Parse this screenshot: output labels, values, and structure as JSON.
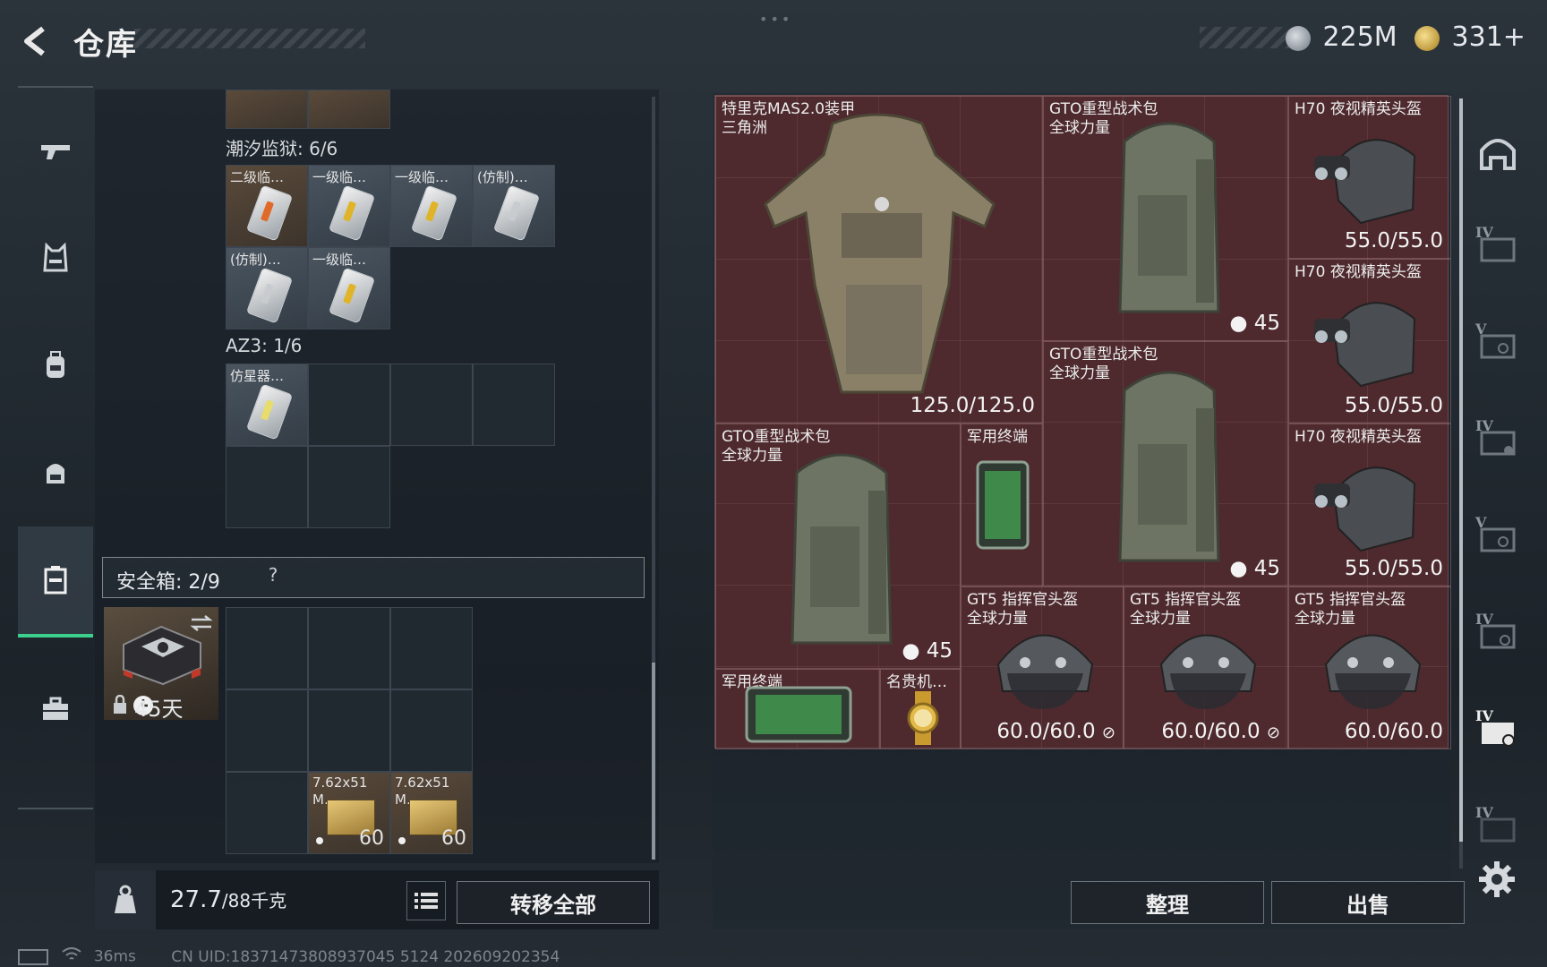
{
  "header": {
    "title": "仓库",
    "currency1": "225M",
    "currency2": "331+",
    "colors": {
      "coin1": "#9aa3ab",
      "coin2": "#d9b44a"
    }
  },
  "left_nav": {
    "items": [
      "gun-icon",
      "vest-icon",
      "bag-icon",
      "helmet-backpack-icon",
      "safebox-icon",
      "briefcase-icon"
    ],
    "active": 4,
    "accent": "#3ccf8e"
  },
  "storage": {
    "section1": {
      "label": "潮汐监狱: 6/6",
      "items": [
        "二级临…",
        "一级临…",
        "一级临…",
        "(仿制)…",
        "(仿制)…",
        "一级临…"
      ]
    },
    "section2": {
      "label": "AZ3: 1/6",
      "items": [
        "仿星器…"
      ]
    }
  },
  "safe_box": {
    "label": "安全箱: 2/9",
    "help": "?",
    "timer": "45天",
    "ammo": [
      {
        "name1": "7.62x51",
        "name2": "M…",
        "count": "60"
      },
      {
        "name1": "7.62x51",
        "name2": "M…",
        "count": "60"
      }
    ]
  },
  "bottom": {
    "weight": "27.7",
    "weight_max": "/88千克",
    "transfer": "转移全部"
  },
  "status": {
    "ping": "36ms",
    "uid": "CN UID:18371473808937045 5124 202609202354"
  },
  "container": {
    "armor": {
      "name1": "特里克MAS2.0装甲",
      "name2": "三角洲",
      "durability": "125.0/125.0"
    },
    "bag1": {
      "name1": "GTO重型战术包",
      "name2": "全球力量",
      "count": "45"
    },
    "bag2": {
      "name1": "GTO重型战术包",
      "name2": "全球力量",
      "count": "45"
    },
    "bag3": {
      "name1": "GTO重型战术包",
      "name2": "全球力量",
      "count": "45"
    },
    "nvg1": {
      "name": "H70 夜视精英头盔",
      "durability": "55.0/55.0"
    },
    "nvg2": {
      "name": "H70 夜视精英头盔",
      "durability": "55.0/55.0"
    },
    "nvg3": {
      "name": "H70 夜视精英头盔",
      "durability": "55.0/55.0"
    },
    "terminal1": {
      "name": "军用终端"
    },
    "terminal2": {
      "name": "军用终端"
    },
    "watch": {
      "name": "名贵机…"
    },
    "gt5_1": {
      "name1": "GT5 指挥官头盔",
      "name2": "全球力量",
      "durability": "60.0/60.0"
    },
    "gt5_2": {
      "name1": "GT5 指挥官头盔",
      "name2": "全球力量",
      "durability": "60.0/60.0"
    },
    "gt5_3": {
      "name1": "GT5 指挥官头盔",
      "name2": "全球力量",
      "durability": "60.0/60.0"
    }
  },
  "right_nav": {
    "levels": [
      "",
      "IV",
      "V",
      "IV",
      "V",
      "IV",
      "IV",
      "IV"
    ],
    "active": 6
  },
  "actions": {
    "sort": "整理",
    "sell": "出售"
  }
}
